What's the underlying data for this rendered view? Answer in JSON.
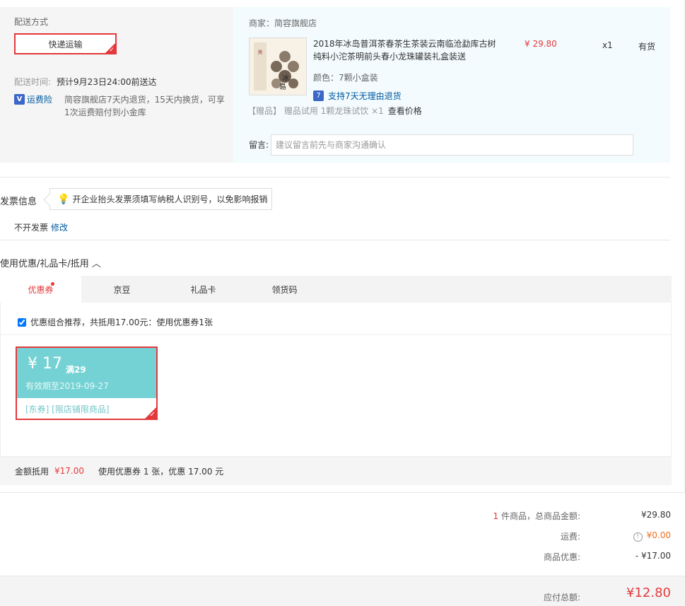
{
  "delivery": {
    "title": "配送方式",
    "option": "快递运输",
    "time_label": "配送时间:",
    "time_value": "预计9月23日24:00前送达",
    "insurance_icon": "shield-icon",
    "insurance_label": "运费险",
    "insurance_desc": "简容旗舰店7天内退货，15天内换货，可享1次运费赔付到小金库"
  },
  "product": {
    "seller": "商家：简容旗舰店",
    "name": "2018年冰岛普洱茶春茶生茶装云南临沧勐库古树纯料小沱茶明前头春小龙珠罐装礼盒装送",
    "price": "¥ 29.80",
    "qty": "x1",
    "stock": "有货",
    "color": "颜色：7颗小盒装",
    "return_icon_text": "7",
    "return_policy": "支持7天无理由退货",
    "gift_prefix": "【赠品】  赠品试用 1颗龙珠试饮 ×1",
    "gift_link": "查看价格",
    "message_label": "留言:",
    "message_placeholder": "建议留言前先与商家沟通确认"
  },
  "invoice": {
    "title": "发票信息",
    "tip": "开企业抬头发票须填写纳税人识别号，以免影响报销",
    "status": "不开发票",
    "edit": "修改"
  },
  "coupons": {
    "title": "使用优惠/礼品卡/抵用 ︿",
    "tabs": [
      "优惠券",
      "京豆",
      "礼品卡",
      "领货码"
    ],
    "combo_text": "优惠组合推荐，共抵用17.00元：使用优惠券1张",
    "card": {
      "amount": "¥ 17",
      "threshold": "满29",
      "valid": "有效期至2019-09-27",
      "tags": "[东券]  [限店铺限商品]"
    },
    "summary_label": "金额抵用",
    "summary_amount": "¥17.00",
    "summary_desc": "使用优惠券 1 张，优惠 17.00 元"
  },
  "totals": {
    "count": "1",
    "items_label": " 件商品，总商品金额:",
    "items_value": "¥29.80",
    "shipping_label": "运费:",
    "shipping_value": "¥0.00",
    "discount_label": "商品优惠:",
    "discount_value": "- ¥17.00",
    "payable_label": "应付总额:",
    "payable_value": "¥12.80"
  },
  "colors": {
    "accent": "#e4393c",
    "coupon": "#74d2d4",
    "link": "#005aa0"
  }
}
